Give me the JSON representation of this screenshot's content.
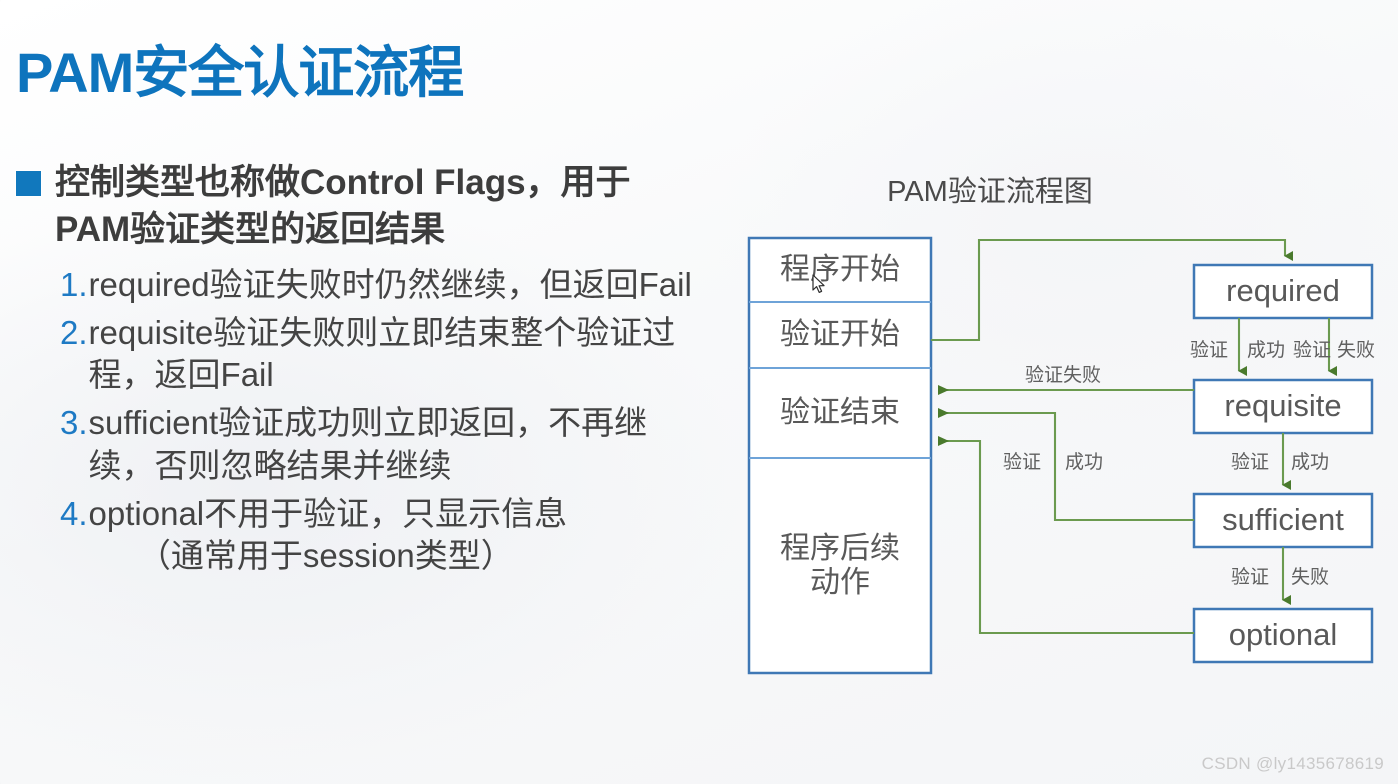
{
  "slide": {
    "title": "PAM安全认证流程",
    "title_color": "#0e74bd",
    "background_color": "#fbfbfb"
  },
  "content": {
    "main_bullet": "控制类型也称做Control Flags，用于PAM验证类型的返回结果",
    "bullet_marker_color": "#1178bd",
    "number_color": "#1e7ac4",
    "items": [
      {
        "num": "1.",
        "text": "required验证失败时仍然继续，但返回Fail",
        "sub": ""
      },
      {
        "num": "2.",
        "text": "requisite验证失败则立即结束整个验证过程，返回Fail",
        "sub": ""
      },
      {
        "num": "3.",
        "text": "sufficient验证成功则立即返回，不再继续，否则忽略结果并继续",
        "sub": ""
      },
      {
        "num": "4.",
        "text": "optional不用于验证，只显示信息",
        "sub": "（通常用于session类型）"
      }
    ]
  },
  "diagram": {
    "title": "PAM验证流程图",
    "box_border_color": "#4a86c5",
    "edge_color": "#6b9a4f",
    "left_column": [
      {
        "label": "程序开始"
      },
      {
        "label": "验证开始"
      },
      {
        "label": "验证结束"
      },
      {
        "label": "程序后续\n动作"
      }
    ],
    "left_column_labels": {
      "start": "程序开始",
      "auth_start": "验证开始",
      "auth_end": "验证结束",
      "post_action_line1": "程序后续",
      "post_action_line2": "动作"
    },
    "right_column": [
      {
        "label": "required"
      },
      {
        "label": "requisite"
      },
      {
        "label": "sufficient"
      },
      {
        "label": "optional"
      }
    ],
    "edge_labels": {
      "required_success_a": "验证",
      "required_success_b": "成功",
      "required_fail_a": "验证",
      "required_fail_b": "失败",
      "requisite_fail_to_end": "验证失败",
      "requisite_success_a": "验证",
      "requisite_success_b": "成功",
      "sufficient_success_a": "验证",
      "sufficient_success_b": "成功",
      "sufficient_fail_a": "验证",
      "sufficient_fail_b": "失败"
    }
  },
  "watermark": "CSDN @ly1435678619"
}
